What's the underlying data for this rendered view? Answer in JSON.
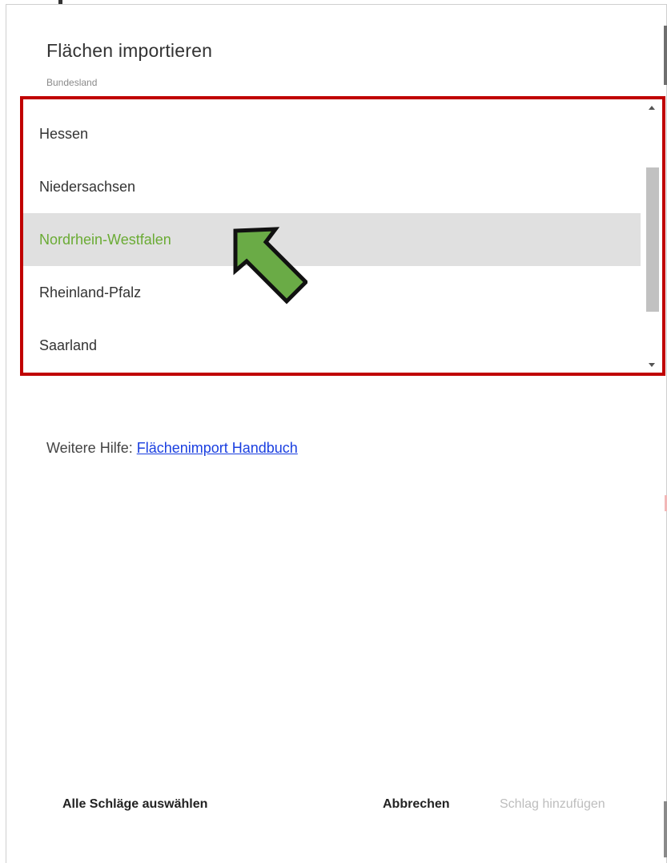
{
  "dialog": {
    "title": "Flächen importieren",
    "field_label": "Bundesland"
  },
  "dropdown": {
    "options": [
      {
        "label": "Hessen"
      },
      {
        "label": "Niedersachsen"
      },
      {
        "label": "Nordrhein-Westfalen"
      },
      {
        "label": "Rheinland-Pfalz"
      },
      {
        "label": "Saarland"
      }
    ],
    "selected": "Nordrhein-Westfalen"
  },
  "help": {
    "prefix": "Weitere Hilfe: ",
    "link_text": "Flächenimport Handbuch"
  },
  "footer": {
    "select_all": "Alle Schläge auswählen",
    "cancel": "Abbrechen",
    "add": "Schlag hinzufügen"
  },
  "colors": {
    "highlight_border": "#c00000",
    "selected_text": "#6aab34",
    "selected_background": "#e0e0e0",
    "arrow_fill": "#6aab46",
    "link": "#1a3fe0"
  }
}
